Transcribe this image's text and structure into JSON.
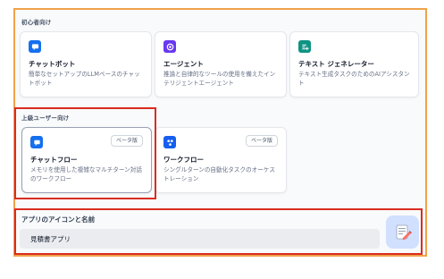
{
  "sections": {
    "beginner_label": "初心者向け",
    "advanced_label": "上級ユーザー向け"
  },
  "beginner_cards": [
    {
      "title": "チャットボット",
      "desc": "簡単なセットアップのLLMベースのチャットボット",
      "icon": "chat-bubble-icon",
      "icon_color": "#1570ef"
    },
    {
      "title": "エージェント",
      "desc": "推論と自律的なツールの使用を備えたインテリジェントエージェント",
      "icon": "agent-icon",
      "icon_color": "#6938ef"
    },
    {
      "title": "テキスト ジェネレーター",
      "desc": "テキスト生成タスクのためのAIアシスタント",
      "icon": "text-generator-icon",
      "icon_color": "#0e9384"
    }
  ],
  "advanced_cards": [
    {
      "title": "チャットフロー",
      "desc": "メモリを使用した複雑なマルチターン対話のワークフロー",
      "badge": "ベータ版",
      "icon": "chatflow-icon",
      "icon_color": "#1570ef"
    },
    {
      "title": "ワークフロー",
      "desc": "シングルターンの自動化タスクのオーケストレーション",
      "badge": "ベータ版",
      "icon": "workflow-icon",
      "icon_color": "#155eef"
    }
  ],
  "app": {
    "label": "アプリのアイコンと名前",
    "name_value": "見積書アプリ",
    "icon": "memo-pencil-icon"
  },
  "colors": {
    "frame_border": "#f0a24a",
    "highlight_border": "#d92d20",
    "selected_card_border": "#98a2b3"
  }
}
